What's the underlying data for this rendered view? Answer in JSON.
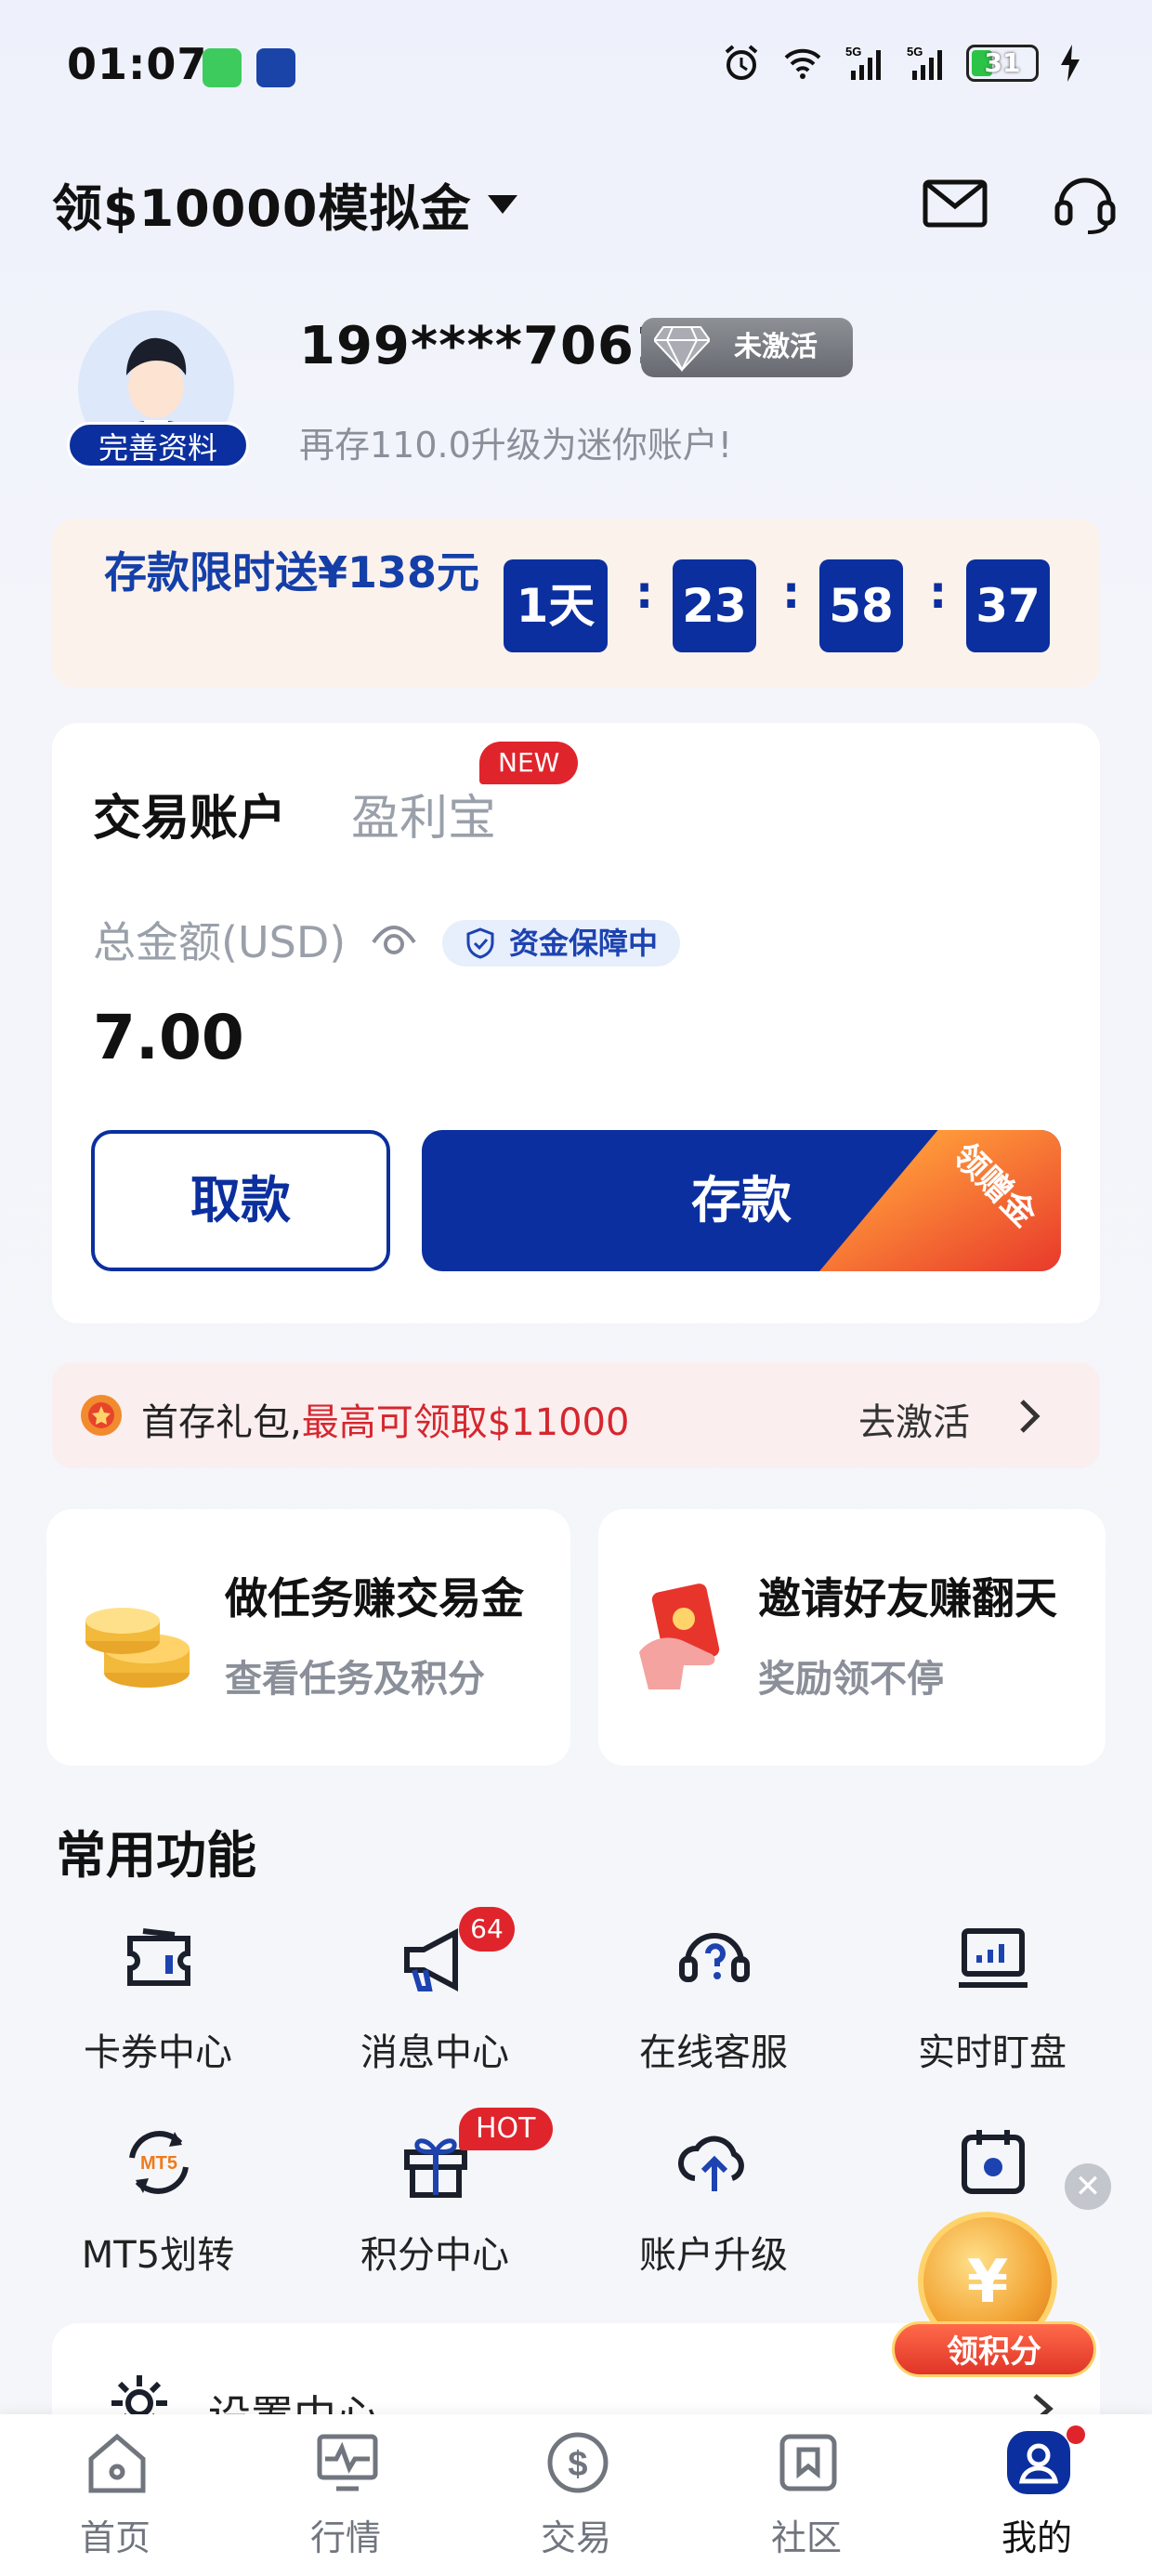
{
  "status_bar": {
    "time": "01:07",
    "battery": "31",
    "net1": "5G",
    "net2": "5G"
  },
  "header": {
    "title": "领$10000模拟金"
  },
  "profile": {
    "avatar_badge": "完善资料",
    "account": "199****7061",
    "status": "未激活",
    "hint": "再存110.0升级为迷你账户!"
  },
  "promo": {
    "text": "存款限时送¥138元",
    "days": "1天",
    "hours": "23",
    "minutes": "58",
    "seconds": "37",
    "sep": ":"
  },
  "account_card": {
    "tab_active": "交易账户",
    "tab_inactive": "盈利宝",
    "new_badge": "NEW",
    "total_label": "总金额(USD)",
    "guard": "资金保障中",
    "total_value": "7.00",
    "withdraw": "取款",
    "deposit": "存款",
    "deposit_ribbon": "领赠金"
  },
  "gift": {
    "text": "首存礼包,",
    "highlight": "最高可领取$11000",
    "action": "去激活"
  },
  "tasks": [
    {
      "title": "做任务赚交易金",
      "sub": "查看任务及积分"
    },
    {
      "title": "邀请好友赚翻天",
      "sub": "奖励领不停"
    }
  ],
  "common": {
    "title": "常用功能",
    "items": [
      {
        "label": "卡券中心",
        "icon": "coupon-icon"
      },
      {
        "label": "消息中心",
        "icon": "megaphone-icon",
        "badge": "64"
      },
      {
        "label": "在线客服",
        "icon": "support-icon"
      },
      {
        "label": "实时盯盘",
        "icon": "monitor-chart-icon"
      },
      {
        "label": "MT5划转",
        "icon": "mt5-transfer-icon"
      },
      {
        "label": "积分中心",
        "icon": "gift-box-icon",
        "badge": "HOT"
      },
      {
        "label": "账户升级",
        "icon": "cloud-upload-icon"
      },
      {
        "label": "",
        "icon": "calendar-icon"
      }
    ]
  },
  "settings": {
    "label": "设置中心"
  },
  "float_widget": {
    "label": "领积分",
    "coin": "¥",
    "close": "✕"
  },
  "tabbar": [
    {
      "label": "首页"
    },
    {
      "label": "行情"
    },
    {
      "label": "交易"
    },
    {
      "label": "社区"
    },
    {
      "label": "我的"
    }
  ],
  "colors": {
    "brand": "#0b2f9e",
    "alert": "#e0242c",
    "promo_bg": "#fcf2ec"
  }
}
